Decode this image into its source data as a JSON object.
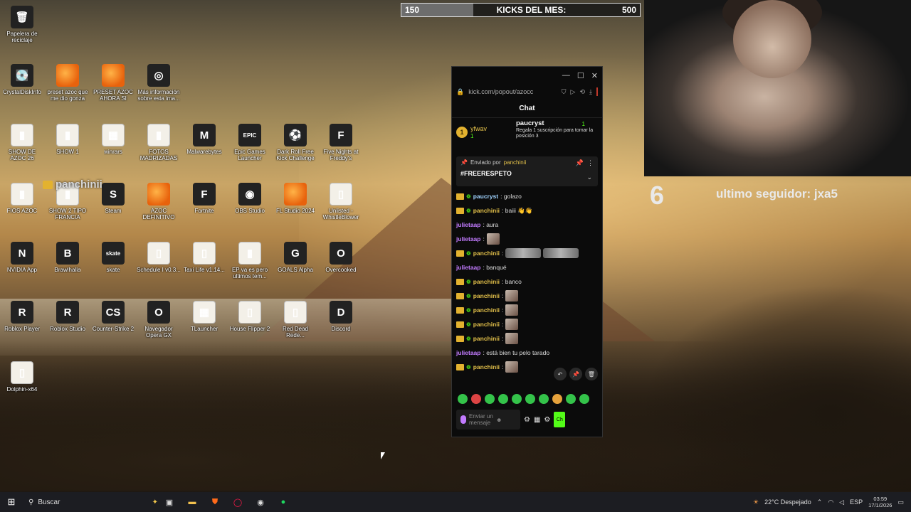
{
  "desktop": {
    "icons": [
      {
        "label": "Papelera de reciclaje",
        "glyph": "🗑"
      },
      {
        "label": "CrystalDiskInfo",
        "glyph": "💽"
      },
      {
        "label": "preset azoc que me dio gonza",
        "glyph": "FL"
      },
      {
        "label": "PRESET AZOC AHORA SI",
        "glyph": "FL"
      },
      {
        "label": "Más información sobre esta ima...",
        "glyph": "◎"
      },
      {
        "label": "SHOW DE AZOC 26",
        "glyph": "▮"
      },
      {
        "label": "SHOW 1",
        "glyph": "▮"
      },
      {
        "label": "winrars",
        "glyph": "▦"
      },
      {
        "label": "FOTOS MADRIZADAS",
        "glyph": "▮"
      },
      {
        "label": "Malwarebytes",
        "glyph": "M"
      },
      {
        "label": "Epic Games Launcher",
        "glyph": "EPIC"
      },
      {
        "label": "Dark Roll Free Kick Challenge",
        "glyph": "⚽"
      },
      {
        "label": "Five Nights at Freddy's",
        "glyph": "F"
      },
      {
        "label": "FIOS AZOC",
        "glyph": "▮"
      },
      {
        "label": "SHOW 2 TIPO FRANCIA",
        "glyph": "▮"
      },
      {
        "label": "Steam",
        "glyph": "S"
      },
      {
        "label": "AZOC DEFINITIVO",
        "glyph": "FL"
      },
      {
        "label": "Fortnite",
        "glyph": "F"
      },
      {
        "label": "OBS Studio",
        "glyph": "◉"
      },
      {
        "label": "FL Studio 2024",
        "glyph": "FL"
      },
      {
        "label": "Unlisted - WhistleBlower",
        "glyph": "▯"
      },
      {
        "label": "NVIDIA App",
        "glyph": "N"
      },
      {
        "label": "Brawlhalla",
        "glyph": "B"
      },
      {
        "label": "skate",
        "glyph": "skate"
      },
      {
        "label": "Schedule I v0.3...",
        "glyph": "▯"
      },
      {
        "label": "Taxi Life v1.14...",
        "glyph": "▯"
      },
      {
        "label": "EP va es pero ultimos tem...",
        "glyph": "▮"
      },
      {
        "label": "GOALS Alpha",
        "glyph": "G"
      },
      {
        "label": "Overcooked",
        "glyph": "O"
      },
      {
        "label": "Roblox Player",
        "glyph": "R"
      },
      {
        "label": "Roblox Studio",
        "glyph": "R"
      },
      {
        "label": "Counter-Strike 2",
        "glyph": "CS"
      },
      {
        "label": "Navegador Opera GX",
        "glyph": "O"
      },
      {
        "label": "TLauncher",
        "glyph": "▦"
      },
      {
        "label": "House Flipper 2",
        "glyph": "▯"
      },
      {
        "label": "Red Dead Rede...",
        "glyph": "▯"
      },
      {
        "label": "Discord",
        "glyph": "D"
      },
      {
        "label": "Dolphin-x64",
        "glyph": "▯"
      }
    ]
  },
  "kicks": {
    "min": "150",
    "title": "KICKS DEL MES:",
    "max": "500",
    "progress": 0.3
  },
  "follower": {
    "count": "6",
    "label": "ultimo seguidor: jxa5"
  },
  "overlay_user": "panchinii",
  "chat": {
    "url": "kick.com/popout/azocc",
    "title": "Chat",
    "gift": {
      "user": "yfwav",
      "user_count": "1",
      "rank": "1",
      "gifter": "paucryst",
      "count": "1",
      "text": "Regala 1 suscripción para tomar la posición 3"
    },
    "pinned": {
      "label": "Enviado por",
      "user": "panchinii",
      "message": "#FREERESPETO"
    },
    "messages": [
      {
        "user": "paucryst",
        "text": ": golazo",
        "style": "blue",
        "badges": true
      },
      {
        "user": "panchinii",
        "text": ": baiii 👋👋",
        "style": "gold",
        "badges": true
      },
      {
        "user": "julietaap",
        "text": ": aura",
        "style": "pink",
        "badges": false
      },
      {
        "user": "julietaap",
        "text": ":",
        "style": "pink",
        "badges": false,
        "emote": "small"
      },
      {
        "user": "panchinii",
        "text": ":",
        "style": "gold",
        "badges": true,
        "emote": "wide"
      },
      {
        "user": "julietaap",
        "text": ": banqué",
        "style": "pink",
        "badges": false
      },
      {
        "user": "panchinii",
        "text": ": banco",
        "style": "gold",
        "badges": true
      },
      {
        "user": "panchinii",
        "text": ":",
        "style": "gold",
        "badges": true,
        "emote": "small"
      },
      {
        "user": "panchinii",
        "text": ":",
        "style": "gold",
        "badges": true,
        "emote": "small"
      },
      {
        "user": "panchinii",
        "text": ":",
        "style": "gold",
        "badges": true,
        "emote": "small"
      },
      {
        "user": "panchinii",
        "text": ":",
        "style": "gold",
        "badges": true,
        "emote": "small"
      },
      {
        "user": "julietaap",
        "text": ": está bien tu pelo tarado",
        "style": "pink",
        "badges": false
      },
      {
        "user": "panchinii",
        "text": ":",
        "style": "gold",
        "badges": true,
        "emote": "small"
      }
    ],
    "input_placeholder": "Enviar un mensaje",
    "send_label": "Ch"
  },
  "taskbar": {
    "search_placeholder": "Buscar",
    "weather": "22°C Despejado",
    "lang": "ESP",
    "time": "03:59",
    "date": "17/1/2026"
  }
}
